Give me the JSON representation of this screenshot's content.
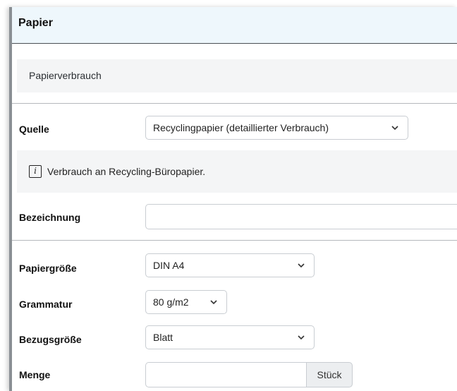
{
  "panel": {
    "title": "Papier",
    "section": "Papierverbrauch"
  },
  "form": {
    "source": {
      "label": "Quelle",
      "value": "Recyclingpapier (detaillierter Verbrauch)"
    },
    "info": {
      "icon": "info-icon",
      "text": "Verbrauch an Recycling-Büropapier."
    },
    "designation": {
      "label": "Bezeichnung",
      "value": ""
    },
    "paper_size": {
      "label": "Papiergröße",
      "value": "DIN A4"
    },
    "grammage": {
      "label": "Grammatur",
      "value": "80 g/m2"
    },
    "reference_unit": {
      "label": "Bezugsgröße",
      "value": "Blatt"
    },
    "quantity": {
      "label": "Menge",
      "value": "",
      "unit": "Stück"
    }
  },
  "icons": {
    "dropdown": "chevron-down-icon",
    "info": "info-icon"
  }
}
